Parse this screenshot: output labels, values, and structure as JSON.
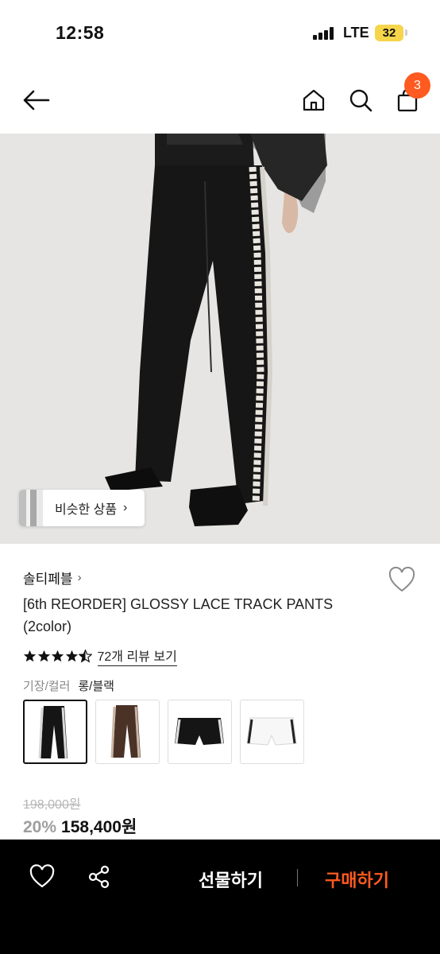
{
  "status_bar": {
    "time": "12:58",
    "network": "LTE",
    "battery": "32"
  },
  "nav": {
    "icons": [
      "back-arrow-icon",
      "home-icon",
      "search-icon",
      "shopping-bag-icon"
    ],
    "cart_count": "3"
  },
  "hero": {
    "similar_label": "비슷한 상품",
    "similar_chevron": "›"
  },
  "product": {
    "brand": "솔티페블",
    "brand_chevron": "›",
    "title": "[6th REORDER] GLOSSY LACE TRACK PANTS (2color)",
    "rating": 4.5,
    "review_link": "72개 리뷰 보기",
    "option_label": "기장/컬러",
    "option_value": "롱/블랙",
    "swatches": [
      "long-black",
      "long-brown",
      "short-black",
      "short-white"
    ],
    "original_price": "198,000원",
    "discount": "20%",
    "price": "158,400원"
  },
  "bottom_bar": {
    "gift_label": "선물하기",
    "buy_label": "구매하기"
  },
  "colors": {
    "accent": "#ff5a1f",
    "bar": "#000000",
    "hero_bg": "#e6e5e3"
  }
}
